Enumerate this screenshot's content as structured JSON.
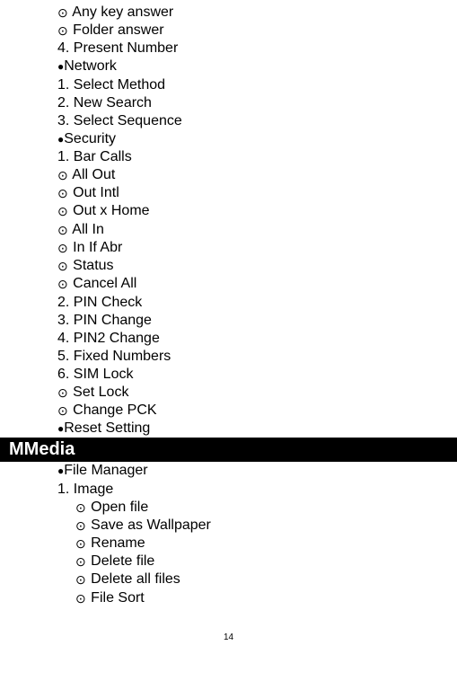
{
  "section1": {
    "items": [
      {
        "type": "circle-dot",
        "text": " Any key answer"
      },
      {
        "type": "circle-dot",
        "text": " Folder answer"
      },
      {
        "type": "plain",
        "text": "4. Present Number"
      },
      {
        "type": "filled-bullet",
        "text": "Network"
      },
      {
        "type": "plain",
        "text": "1. Select Method"
      },
      {
        "type": "plain",
        "text": "2. New Search"
      },
      {
        "type": "plain",
        "text": "3. Select Sequence"
      },
      {
        "type": "filled-bullet",
        "text": "Security"
      },
      {
        "type": "plain",
        "text": "1. Bar Calls"
      },
      {
        "type": "circle-dot",
        "text": " All Out"
      },
      {
        "type": "circle-dot",
        "text": " Out Intl"
      },
      {
        "type": "circle-dot",
        "text": " Out x Home"
      },
      {
        "type": "circle-dot",
        "text": " All In"
      },
      {
        "type": "circle-dot",
        "text": " In If Abr"
      },
      {
        "type": "circle-dot",
        "text": " Status"
      },
      {
        "type": "circle-dot",
        "text": " Cancel All"
      },
      {
        "type": "plain",
        "text": "2. PIN Check"
      },
      {
        "type": "plain",
        "text": "3. PIN Change"
      },
      {
        "type": "plain",
        "text": "4. PIN2 Change"
      },
      {
        "type": "plain",
        "text": "5. Fixed Numbers"
      },
      {
        "type": "plain",
        "text": "6. SIM Lock"
      },
      {
        "type": "circle-dot",
        "text": " Set Lock"
      },
      {
        "type": "circle-dot",
        "text": " Change PCK"
      },
      {
        "type": "filled-bullet",
        "text": "Reset Setting"
      }
    ]
  },
  "header": {
    "title": " MMedia"
  },
  "section2": {
    "items": [
      {
        "type": "filled-bullet",
        "text": "File Manager",
        "indent": false
      },
      {
        "type": "plain",
        "text": "1. Image",
        "indent": false
      },
      {
        "type": "circle-dot",
        "text": " Open file",
        "indent": true
      },
      {
        "type": "circle-dot",
        "text": " Save as Wallpaper",
        "indent": true
      },
      {
        "type": "circle-dot",
        "text": " Rename",
        "indent": true
      },
      {
        "type": "circle-dot",
        "text": " Delete file",
        "indent": true
      },
      {
        "type": "circle-dot",
        "text": " Delete all files",
        "indent": true
      },
      {
        "type": "circle-dot",
        "text": " File Sort",
        "indent": true
      }
    ]
  },
  "page": {
    "number": "14"
  }
}
